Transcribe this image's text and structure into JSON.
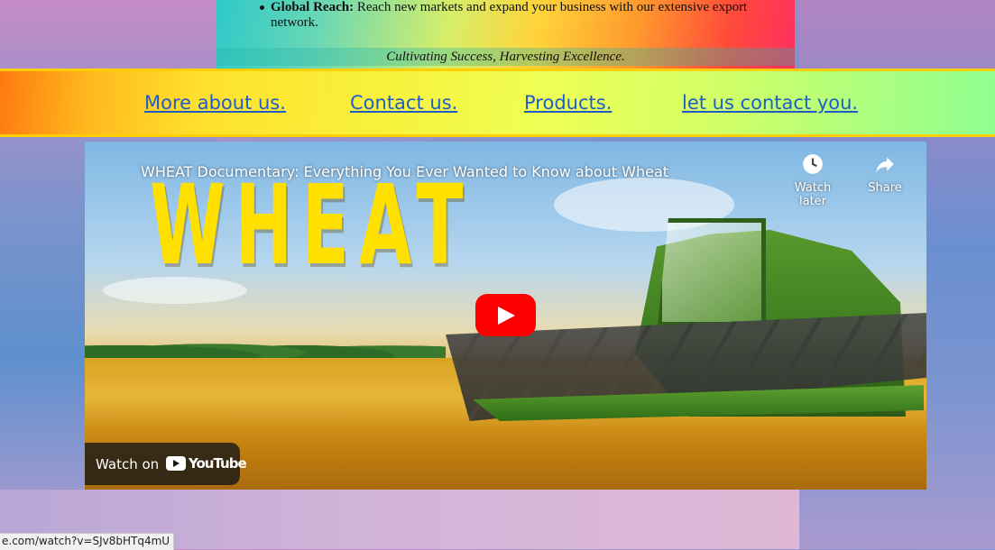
{
  "info_panel": {
    "bullet": {
      "title": "Global Reach:",
      "text": "Reach new markets and expand your business with our extensive export network."
    },
    "tagline": "Cultivating Success, Harvesting Excellence."
  },
  "nav": {
    "links": [
      {
        "label": "More about us."
      },
      {
        "label": "Contact us."
      },
      {
        "label": "Products."
      },
      {
        "label": "let us contact you."
      }
    ]
  },
  "video": {
    "title": "WHEAT Documentary: Everything You Ever Wanted to Know about Wheat",
    "overlay_word": "WHEAT",
    "watch_later_label": "Watch later",
    "share_label": "Share",
    "watch_on_label": "Watch on",
    "youtube_label": "YouTube",
    "play_icon": "play-icon",
    "clock_icon": "clock-icon",
    "share_icon": "share-arrow-icon"
  },
  "status_bar": {
    "url": "e.com/watch?v=SJv8bHTq4mU"
  },
  "colors": {
    "nav_link": "#1f5ec8",
    "nav_border": "#ffd000",
    "play_button": "#ff0000"
  }
}
